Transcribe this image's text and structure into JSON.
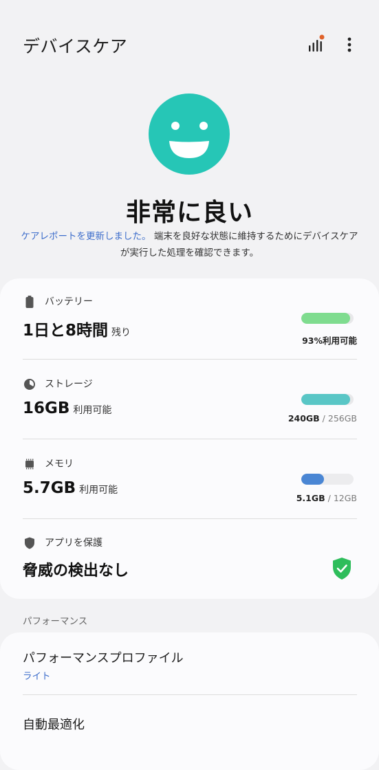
{
  "header": {
    "title": "デバイスケア",
    "report_icon": "report-chart-icon",
    "more_icon": "more-vertical-icon"
  },
  "status": {
    "face_icon": "happy-face-icon",
    "face_color": "#26c6b6",
    "title": "非常に良い",
    "link_text": "ケアレポートを更新しました。",
    "description": "端末を良好な状態に維持するためにデバイスケアが実行した処理を確認できます。"
  },
  "battery": {
    "icon": "battery-icon",
    "label": "バッテリー",
    "value": "1日と8時間",
    "suffix": "残り",
    "bar_fraction": 0.93,
    "bar_color": "#7fdc8f",
    "caption": "93%利用可能"
  },
  "storage": {
    "icon": "storage-pie-icon",
    "label": "ストレージ",
    "value": "16GB",
    "suffix": "利用可能",
    "bar_fraction": 0.9375,
    "bar_color": "#59c6c6",
    "caption_used": "240GB",
    "caption_sep": " / ",
    "caption_total": "256GB"
  },
  "memory": {
    "icon": "memory-chip-icon",
    "label": "メモリ",
    "value": "5.7GB",
    "suffix": "利用可能",
    "bar_fraction": 0.43,
    "bar_color": "#4a86d4",
    "caption_used": "5.1GB",
    "caption_sep": " / ",
    "caption_total": "12GB"
  },
  "app_protection": {
    "icon": "shield-icon",
    "label": "アプリを保護",
    "value": "脅威の検出なし",
    "status_icon": "shield-check-icon",
    "status_color": "#2ebd5b"
  },
  "performance": {
    "section_label": "パフォーマンス",
    "profile_title": "パフォーマンスプロファイル",
    "profile_value": "ライト",
    "auto_optimize": "自動最適化"
  },
  "colors": {
    "accent": "#3e6ecb",
    "badge_dot": "#e0622a"
  }
}
